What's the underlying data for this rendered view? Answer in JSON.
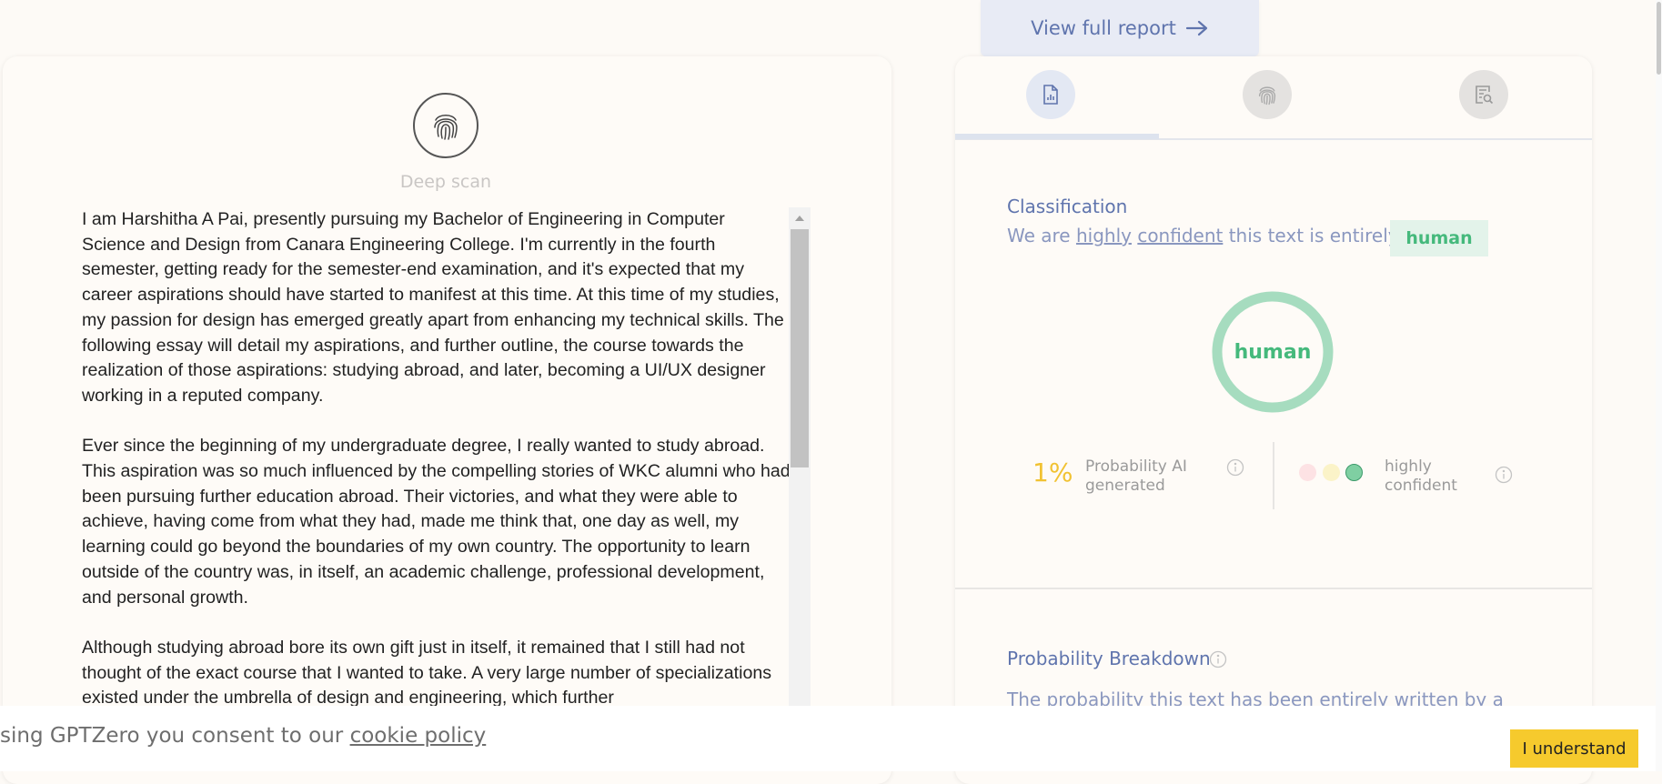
{
  "report_button": {
    "label": "View full report",
    "icon": "arrow-right-icon"
  },
  "deep_scan": {
    "label": "Deep scan",
    "icon": "fingerprint-icon"
  },
  "essay": {
    "paragraphs": [
      "I am Harshitha A Pai, presently pursuing my Bachelor of Engineering in Computer Science and Design from Canara Engineering College. I'm currently in the fourth semester, getting ready for the semester-end examination, and it's expected that my career aspirations should have started to manifest at this time. At this time of my studies, my passion for design has emerged greatly apart from enhancing my technical skills. The following essay will detail my aspirations, and further outline, the course towards the realization of those aspirations: studying abroad, and later, becoming a UI/UX designer working in a reputed company.",
      "Ever since the beginning of my undergraduate degree, I really wanted to study abroad. This aspiration was so much influenced by the compelling stories of WKC alumni who had been pursuing further education abroad. Their victories, and what they were able to achieve, having come from what they had, made me think that, one day as well, my learning could go beyond the boundaries of my own country. The opportunity to learn outside of the country was, in itself, an academic challenge, professional development, and personal growth.",
      "Although studying abroad bore its own gift just in itself, it remained that I still had not thought of the exact course that I wanted to take. A very large number of specializations existed under the umbrella of design and engineering, which further"
    ]
  },
  "tabs": [
    {
      "name": "document-report-icon",
      "active": true
    },
    {
      "name": "fingerprint-icon",
      "active": false
    },
    {
      "name": "document-search-icon",
      "active": false
    }
  ],
  "classification": {
    "title": "Classification",
    "sentence_start": "We are",
    "word_highly": "highly",
    "word_confident": "confident",
    "sentence_end": "this text is entirely",
    "badge": "human",
    "ring_label": "human",
    "probability_value": "1%",
    "probability_label": "Probability AI generated",
    "confidence_label": "highly confident"
  },
  "breakdown": {
    "title": "Probability Breakdown",
    "text": "The probability this text has been entirely written by a"
  },
  "cookie": {
    "text": "sing GPTZero you consent to our",
    "link": "cookie policy",
    "button": "I understand"
  },
  "colors": {
    "accent": "#5f74ad",
    "human_green": "#45b97c",
    "probability_yellow": "#f1c232",
    "button_yellow": "#f6ca2d"
  }
}
